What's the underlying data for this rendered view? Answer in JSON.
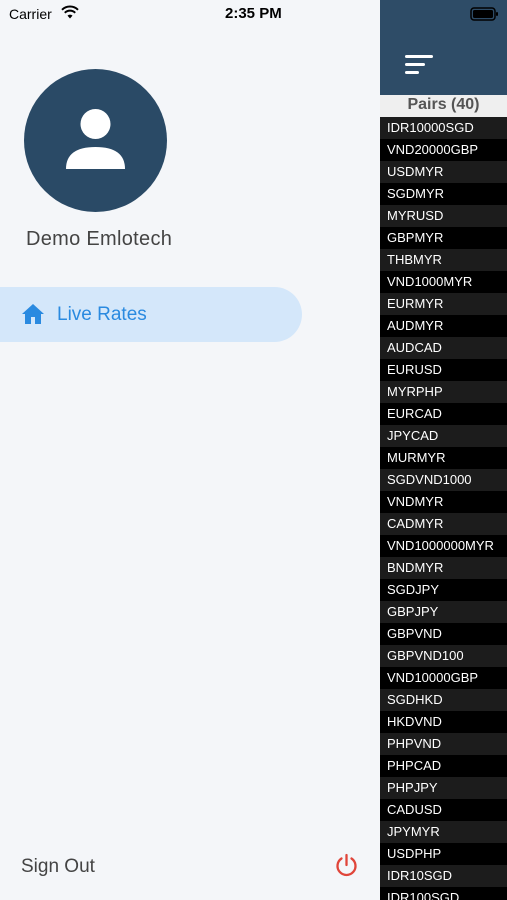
{
  "status_bar": {
    "carrier": "Carrier",
    "time": "2:35 PM"
  },
  "drawer": {
    "user_name": "Demo Emlotech",
    "nav_items": [
      {
        "label": "Live Rates",
        "icon": "home-icon",
        "active": true
      }
    ],
    "signout_label": "Sign Out"
  },
  "rates_panel": {
    "title": "Pairs (40)",
    "pairs": [
      "IDR10000SGD",
      "VND20000GBP",
      "USDMYR",
      "SGDMYR",
      "MYRUSD",
      "GBPMYR",
      "THBMYR",
      "VND1000MYR",
      "EURMYR",
      "AUDMYR",
      "AUDCAD",
      "EURUSD",
      "MYRPHP",
      "EURCAD",
      "JPYCAD",
      "MURMYR",
      "SGDVND1000",
      "VNDMYR",
      "CADMYR",
      "VND1000000MYR",
      "BNDMYR",
      "SGDJPY",
      "GBPJPY",
      "GBPVND",
      "GBPVND100",
      "VND10000GBP",
      "SGDHKD",
      "HKDVND",
      "PHPVND",
      "PHPCAD",
      "PHPJPY",
      "CADUSD",
      "JPYMYR",
      "USDPHP",
      "IDR10SGD",
      "IDR100SGD"
    ]
  },
  "colors": {
    "accent": "#2a8ae0",
    "avatar_bg": "#2a4a66",
    "header_band": "#2e4c67",
    "signout_icon": "#e0453a"
  }
}
